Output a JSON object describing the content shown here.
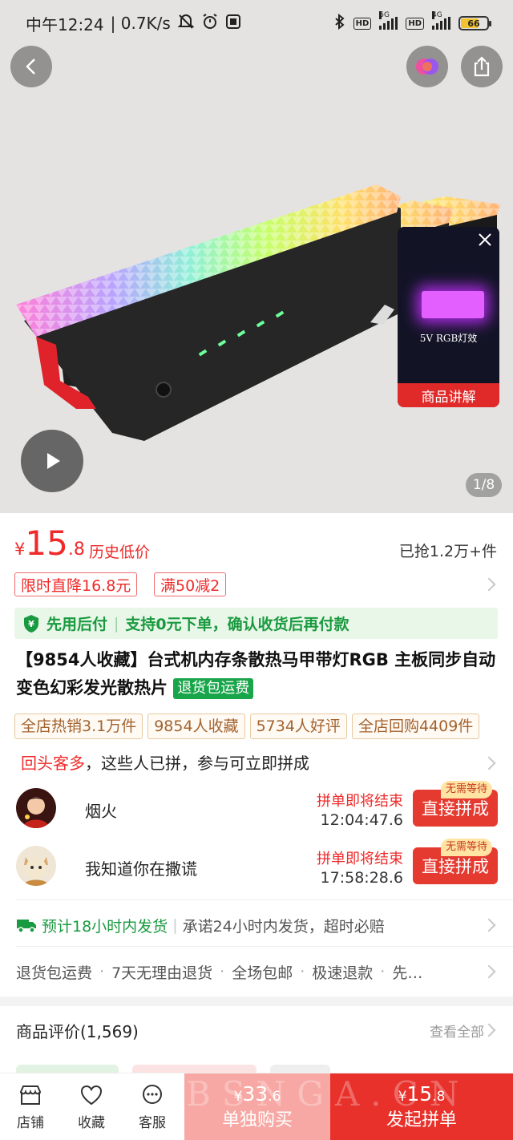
{
  "status_bar": {
    "time": "中午12:24",
    "net_speed": "| 0.7K/s",
    "sim1_gen": "5G",
    "sim2_gen": "4G",
    "hd_label": "HD",
    "battery": "66",
    "battery_level": 0.66
  },
  "hero": {
    "page_indicator": "1/8",
    "pip": {
      "caption": "5V  RGB灯效",
      "bar_label": "商品讲解"
    }
  },
  "price": {
    "currency": "¥",
    "integer": "15",
    "decimal": ".8",
    "tag": "历史低价",
    "sold": "已抢1.2万+件"
  },
  "coupons": [
    "限时直降16.8元",
    "满50减2"
  ],
  "pay_later": {
    "part1": "先用后付",
    "part2": "支持0元下单，确认收货后再付款"
  },
  "title": {
    "text": "【9854人收藏】台式机内存条散热马甲带灯RGB 主板同步自动变色幻彩发光散热片",
    "tag": "退货包运费"
  },
  "badges": [
    "全店热销3.1万件",
    "9854人收藏",
    "5734人好评",
    "全店回购4409件"
  ],
  "group_buy": {
    "title_highlight": "回头客多",
    "title_rest": "，这些人已拼，参与可立即拼成",
    "items": [
      {
        "name": "烟火",
        "status": "拼单即将结束",
        "countdown": "12:04:47.6",
        "button": "直接拼成",
        "badge": "无需等待"
      },
      {
        "name": "我知道你在撒谎",
        "status": "拼单即将结束",
        "countdown": "17:58:28.6",
        "button": "直接拼成",
        "badge": "无需等待"
      }
    ]
  },
  "shipping": {
    "green": "预计18小时内发货",
    "grey": "承诺24小时内发货，超时必赔"
  },
  "services": [
    "退货包运费",
    "7天无理由退货",
    "全场包邮",
    "极速退款",
    "先…"
  ],
  "reviews": {
    "title": "商品评价(1,569)",
    "view_all": "查看全部"
  },
  "bottom_bar": {
    "store": "店铺",
    "favorite": "收藏",
    "service": "客服",
    "solo": {
      "currency": "¥",
      "integer": "33",
      "decimal": ".6",
      "label": "单独购买"
    },
    "group": {
      "currency": "¥",
      "integer": "15",
      "decimal": ".8",
      "label": "发起拼单"
    },
    "watermark": "BSNGA.CN"
  },
  "colors": {
    "accent_red": "#e8312b",
    "price_red": "#ef2a2a",
    "green": "#1a9a40",
    "badge_brown": "#a3632f",
    "solo_btn": "#f7a8a4"
  },
  "icons": [
    "back-icon",
    "live-icon",
    "share-icon",
    "play-icon",
    "close-icon",
    "shield-icon",
    "truck-icon",
    "store-icon",
    "heart-icon",
    "chat-icon",
    "chevron-right-icon"
  ]
}
